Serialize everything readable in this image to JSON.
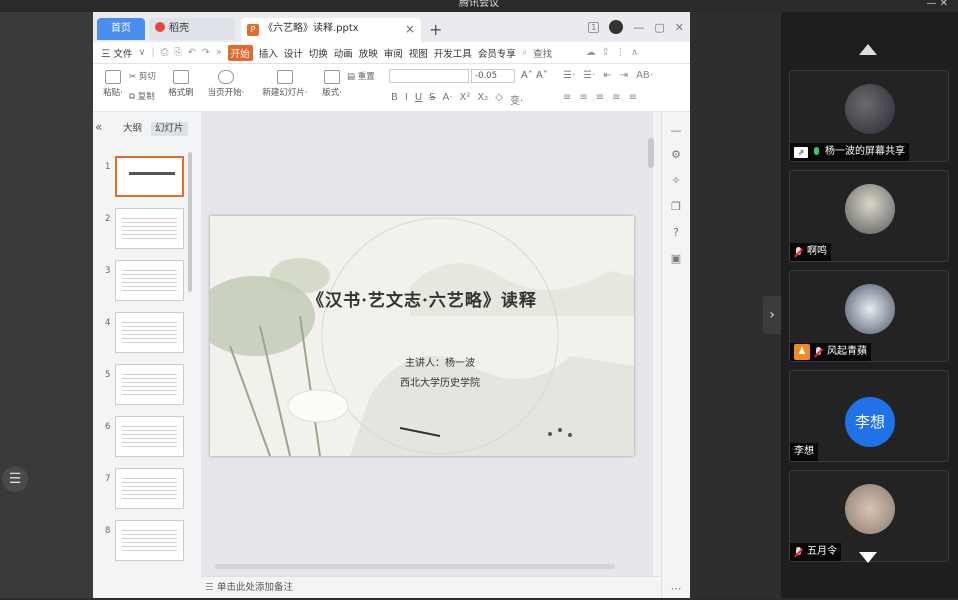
{
  "window": {
    "title": "腾讯会议",
    "controls": "—  ✕"
  },
  "wps": {
    "tabs": {
      "home": "首页",
      "shell": "稻壳",
      "doc": "《六艺略》读释.pptx",
      "doc_icon": "P",
      "close": "×",
      "add": "+"
    },
    "tab_right": {
      "badge": "1",
      "min": "—",
      "max": "▢",
      "close": "✕"
    },
    "menu": {
      "file": "三 文件",
      "arrow": "∨",
      "more": "»",
      "items": [
        "开始",
        "插入",
        "设计",
        "切换",
        "动画",
        "放映",
        "审阅",
        "视图",
        "开发工具",
        "会员专享"
      ],
      "search": "查找"
    },
    "ribbon": {
      "paste": "粘贴·",
      "cut": "剪切",
      "copy": "复制",
      "format_painter": "格式刷",
      "from_current": "当页开始·",
      "new_slide": "新建幻灯片·",
      "layout": "版式·",
      "reset": "重置",
      "font_size": "-0.05",
      "fmt_buttons": [
        "B",
        "I",
        "U",
        "S",
        "A·",
        "X²",
        "X₂",
        "◇",
        "变·"
      ],
      "align_row1": [
        "☰·",
        "☰·",
        "⇤",
        "⇥",
        "AB·"
      ],
      "align_row2": [
        "≡",
        "≡",
        "≡",
        "≡",
        "≡"
      ]
    },
    "panel": {
      "collapse": "«",
      "outline_tab": "大纲",
      "slides_tab": "幻灯片",
      "slide_numbers": [
        "1",
        "2",
        "3",
        "4",
        "5",
        "6",
        "7",
        "8"
      ],
      "add": "+"
    },
    "slide": {
      "title": "《汉书·艺文志·六艺略》读释",
      "speaker": "主讲人：杨一波",
      "institution": "西北大学历史学院"
    },
    "notes": {
      "placeholder": "单击此处添加备注"
    }
  },
  "meeting": {
    "participants": [
      {
        "name": "杨一波的屏幕共享",
        "mic": "on",
        "sharing": true
      },
      {
        "name": "啊鸣",
        "mic": "off"
      },
      {
        "name": "风起青蘋",
        "mic": "off",
        "host": true
      },
      {
        "name": "李想",
        "mic": "none",
        "initials": "李想"
      },
      {
        "name": "五月令",
        "mic": "off"
      }
    ],
    "colors": {
      "avatar_blue": "#1f72e8",
      "mic_on": "#3cc46a",
      "host_badge": "#f08a24"
    }
  },
  "colors": {
    "wps_accent": "#e46a2e",
    "home_tab": "#4a8ef0"
  }
}
